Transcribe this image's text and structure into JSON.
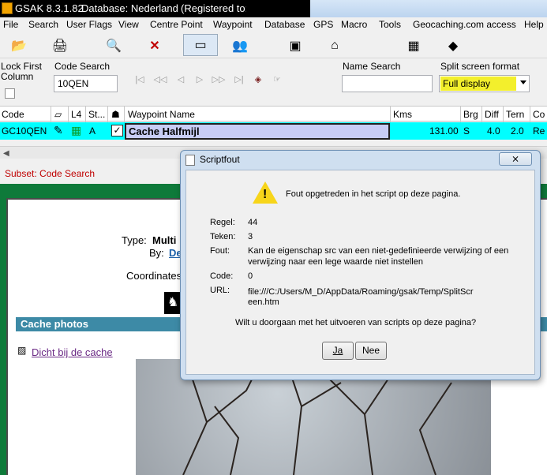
{
  "titlebar": {
    "app_version": "GSAK 8.3.1.82",
    "database": "Database: Nederland",
    "registered": "(Registered to:"
  },
  "menu": [
    "File",
    "Search",
    "User Flags",
    "View",
    "Centre Point",
    "Waypoint",
    "Database",
    "GPS",
    "Macro",
    "Tools",
    "Geocaching.com access",
    "Help"
  ],
  "search": {
    "lock_first_column": "Lock First Column",
    "lock_first_column_line2": "Column",
    "code_search_label": "Code Search",
    "code_search_value": "10QEN",
    "name_search_label": "Name Search",
    "name_search_value": "",
    "split_screen_label": "Split screen format",
    "split_screen_value": "Full display"
  },
  "grid": {
    "headers": [
      "Code",
      "L4",
      "St...",
      "Waypoint Name",
      "Kms",
      "Brg",
      "Diff",
      "Tern",
      "Co"
    ],
    "row": {
      "code": "GC10QEN",
      "status": "A",
      "name": "Cache Halfmijl",
      "kms": "131.00",
      "brg": "S",
      "diff": "4.0",
      "tern": "2.0",
      "co": "Re"
    }
  },
  "subset": "Subset:  Code Search",
  "page": {
    "type_label": "Type: ",
    "type_value": "Multi",
    "by_label": "By: ",
    "by_value": "De",
    "coordinates_label": "Coordinates",
    "cache_photos": "Cache photos",
    "photo_link": "Dicht bij de cache"
  },
  "dialog": {
    "title": "Scriptfout",
    "close": "⨯",
    "message": "Fout opgetreden in het script op deze pagina.",
    "regel_label": "Regel:",
    "regel_value": "44",
    "teken_label": "Teken:",
    "teken_value": "3",
    "fout_label": "Fout:",
    "fout_value_1": "Kan de eigenschap src van een niet-gedefinieerde verwijzing of een",
    "fout_value_2": "verwijzing naar een lege waarde niet instellen",
    "code_label": "Code:",
    "code_value": "0",
    "url_label": "URL:",
    "url_value_1": "file:///C:/Users/M_D/AppData/Roaming/gsak/Temp/SplitScr",
    "url_value_2": "een.htm",
    "question": "Wilt u doorgaan met het uitvoeren van scripts op deze pagina?",
    "yes": "Ja",
    "no": "Nee"
  },
  "colors": {
    "highlight_yellow": "#f3ef2c",
    "grid_row_cyan": "#00ffff",
    "page_green": "#0e7a3a",
    "photo_header": "#3d8aa6",
    "subset_red": "#c00000"
  }
}
